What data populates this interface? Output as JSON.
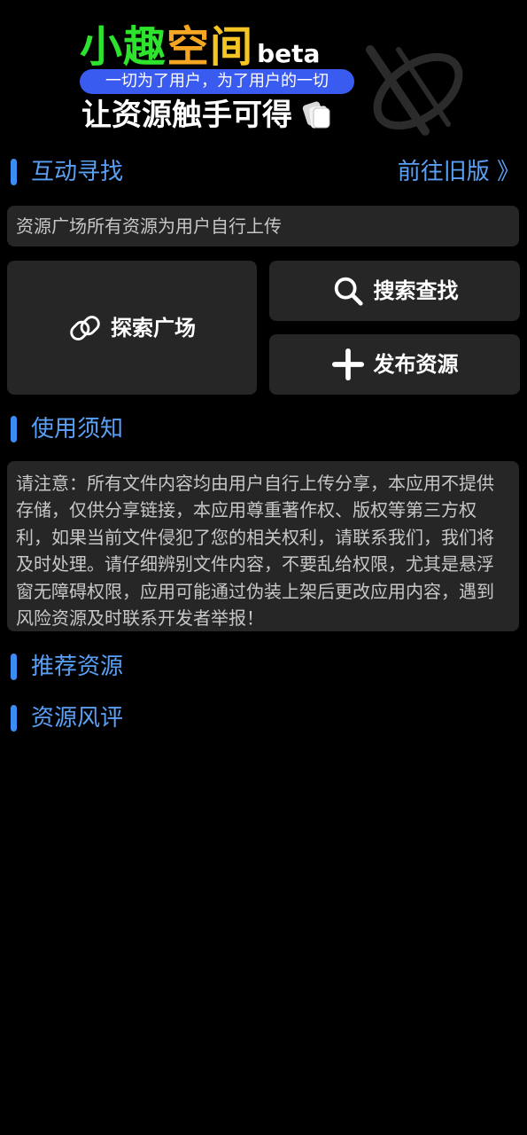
{
  "banner": {
    "title_chars": [
      {
        "text": "小",
        "color": "#2ee32e"
      },
      {
        "text": "趣",
        "color": "#2ee32e"
      },
      {
        "text": "空",
        "color": "#f5a623"
      },
      {
        "text": "间",
        "color": "#f5c623"
      }
    ],
    "beta": "beta",
    "slogan": "一切为了用户，为了用户的一切",
    "tagline": "让资源触手可得"
  },
  "sections": {
    "interactive": {
      "title": "互动寻找",
      "old_version_link": "前往旧版 》"
    },
    "usage": {
      "title": "使用须知"
    },
    "recommended": {
      "title": "推荐资源"
    },
    "reviews": {
      "title": "资源风评"
    }
  },
  "notice": "资源广场所有资源为用户自行上传",
  "actions": {
    "explore": {
      "label": "探索广场",
      "icon": "compass-icon"
    },
    "search": {
      "label": "搜索查找",
      "icon": "search-icon"
    },
    "publish": {
      "label": "发布资源",
      "icon": "plus-icon"
    }
  },
  "terms": "请注意：所有文件内容均由用户自行上传分享，本应用不提供存储，仅供分享链接，本应用尊重著作权、版权等第三方权利，如果当前文件侵犯了您的相关权利，请联系我们，我们将及时处理。请仔细辨别文件内容，不要乱给权限，尤其是悬浮窗无障碍权限，应用可能通过伪装上架后更改应用内容，遇到风险资源及时联系开发者举报！",
  "colors": {
    "accent": "#3b8cf5",
    "section_title": "#5aa0f5",
    "card_bg": "#262626",
    "slogan_pill": "#3a5bf0"
  }
}
